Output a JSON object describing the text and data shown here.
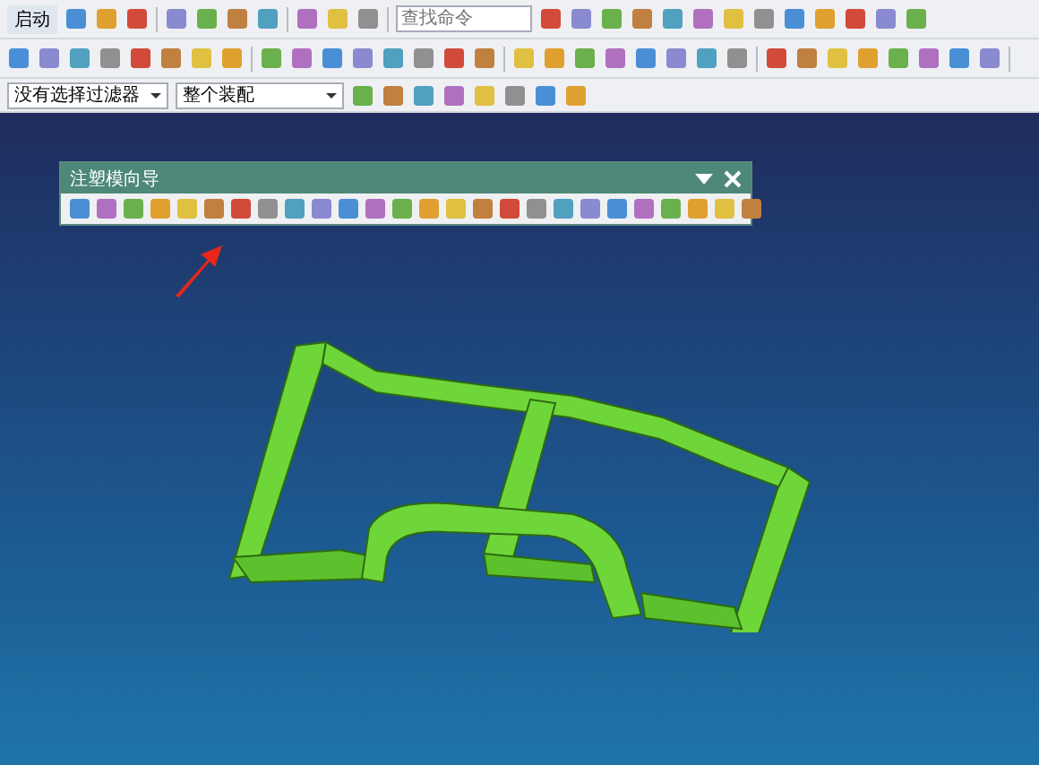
{
  "toolbar": {
    "start_menu": {
      "label": "启动"
    },
    "search": {
      "placeholder": "查找命令"
    },
    "filter_dropdown": {
      "value": "没有选择过滤器"
    },
    "scope_dropdown": {
      "value": "整个装配"
    }
  },
  "floating_panel": {
    "title": "注塑模向导"
  }
}
